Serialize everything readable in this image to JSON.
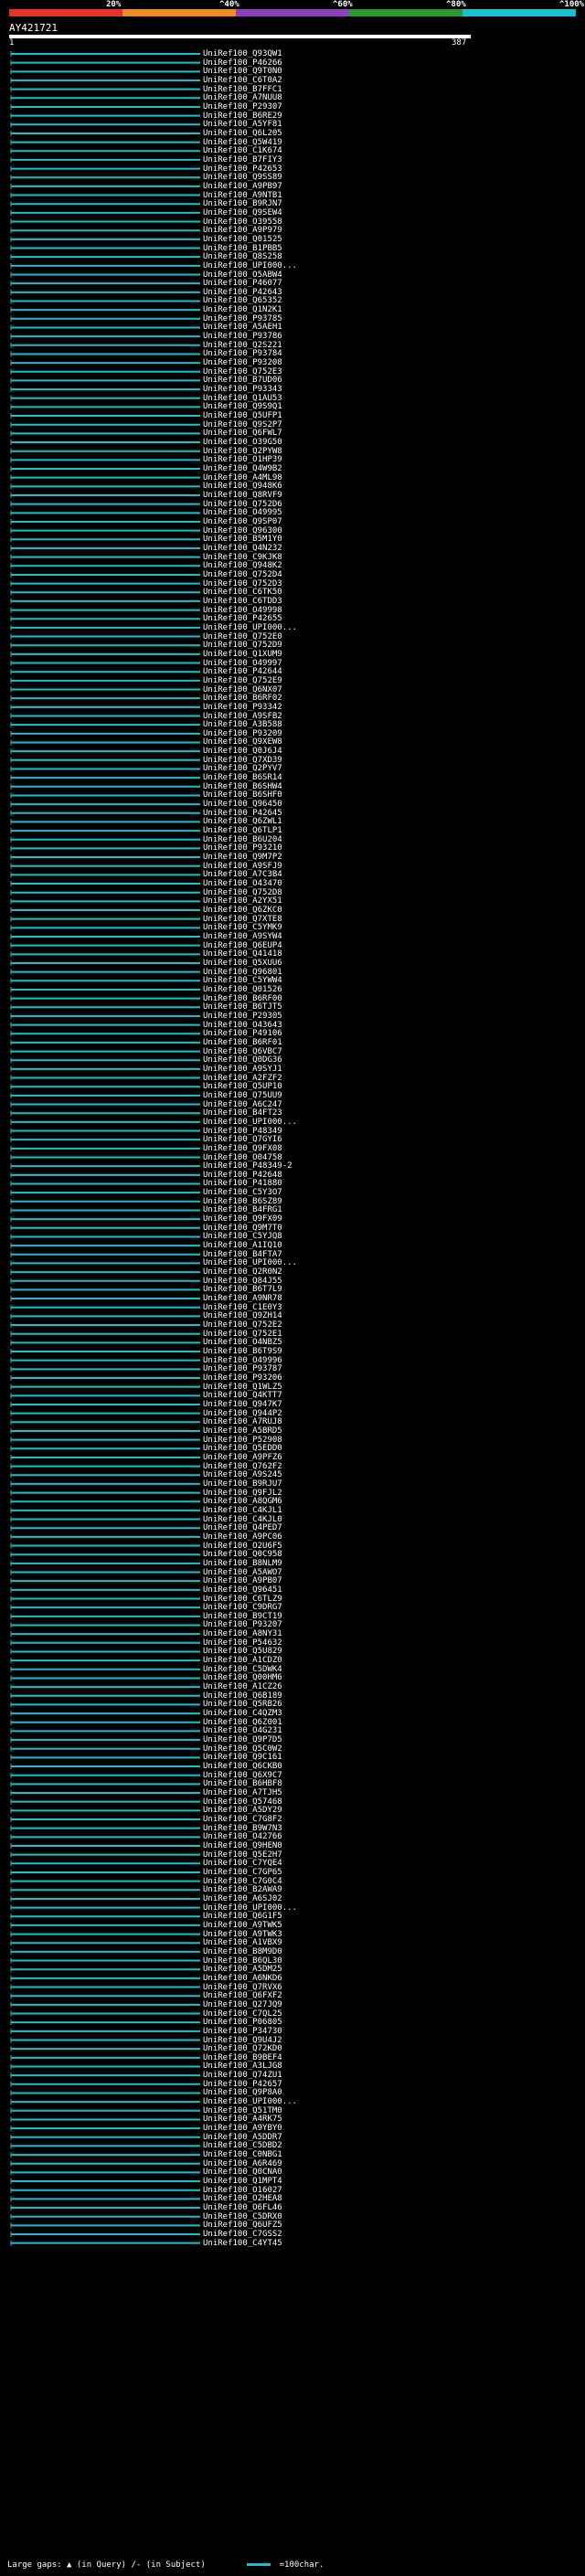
{
  "chart_data": {
    "type": "alignment-overview",
    "query": {
      "id": "AY421721",
      "length": 387
    },
    "scale": {
      "labels": [
        "20%",
        "^40%",
        "^60%",
        "^80%",
        "^100%"
      ],
      "colors": [
        "#e5332a",
        "#f08a24",
        "#8c3fbf",
        "#2d9a2d",
        "#19c1d0"
      ]
    },
    "hit_color": "#19c1d0",
    "hits": [
      "UniRef100_Q93QW1",
      "UniRef100_P46266",
      "UniRef100_Q9T0N0",
      "UniRef100_C6T0A2",
      "UniRef100_B7FFC1",
      "UniRef100_A7NUU8",
      "UniRef100_P29307",
      "UniRef100_B6RE29",
      "UniRef100_A5YF81",
      "UniRef100_Q6L205",
      "UniRef100_Q5W419",
      "UniRef100_C1K674",
      "UniRef100_B7FIY3",
      "UniRef100_P42653",
      "UniRef100_Q9SS89",
      "UniRef100_A9PB97",
      "UniRef100_A9NTB1",
      "UniRef100_B9RJN7",
      "UniRef100_Q9SEW4",
      "UniRef100_O39558",
      "UniRef100_A9P979",
      "UniRef100_Q01525",
      "UniRef100_B1PBB5",
      "UniRef100_Q8S258",
      "UniRef100_UPI000...",
      "UniRef100_O5ABW4",
      "UniRef100_P46077",
      "UniRef100_P42643",
      "UniRef100_Q65352",
      "UniRef100_Q1N2K1",
      "UniRef100_P93785",
      "UniRef100_A5AEH1",
      "UniRef100_P93786",
      "UniRef100_Q2S221",
      "UniRef100_P93784",
      "UniRef100_P93208",
      "UniRef100_Q752E3",
      "UniRef100_B7UD06",
      "UniRef100_P93343",
      "UniRef100_Q1AU53",
      "UniRef100_Q9S9Q1",
      "UniRef100_Q5UFP1",
      "UniRef100_Q9S2P7",
      "UniRef100_Q6FWL7",
      "UniRef100_O39G50",
      "UniRef100_Q2PYW8",
      "UniRef100_O1HP39",
      "UniRef100_Q4W9B2",
      "UniRef100_A4ML98",
      "UniRef100_Q948K6",
      "UniRef100_Q8RVF9",
      "UniRef100_Q752D6",
      "UniRef100_O49995",
      "UniRef100_Q9SP07",
      "UniRef100_Q96300",
      "UniRef100_B5M1Y0",
      "UniRef100_Q4N232",
      "UniRef100_C9KJK8",
      "UniRef100_Q948K2",
      "UniRef100_Q752D4",
      "UniRef100_Q752D3",
      "UniRef100_C6TK50",
      "UniRef100_C6TDD3",
      "UniRef100_O49998",
      "UniRef100_P42655",
      "UniRef100_UPI000...",
      "UniRef100_Q752E0",
      "UniRef100_Q752D9",
      "UniRef100_Q1XUM9",
      "UniRef100_O49997",
      "UniRef100_P42644",
      "UniRef100_Q752E9",
      "UniRef100_Q6NX07",
      "UniRef100_B6RF02",
      "UniRef100_P93342",
      "UniRef100_A9SFB2",
      "UniRef100_A3B588",
      "UniRef100_P93209",
      "UniRef100_Q9XEW8",
      "UniRef100_Q0J6J4",
      "UniRef100_Q7XD39",
      "UniRef100_Q2PYV7",
      "UniRef100_B6SR14",
      "UniRef100_B6SHW4",
      "UniRef100_B6SHF0",
      "UniRef100_Q96450",
      "UniRef100_P42645",
      "UniRef100_Q6ZWL1",
      "UniRef100_Q6TLP1",
      "UniRef100_B6U204",
      "UniRef100_P93210",
      "UniRef100_Q9M7P2",
      "UniRef100_A9SFJ9",
      "UniRef100_A7C3B4",
      "UniRef100_O43470",
      "UniRef100_Q752D8",
      "UniRef100_A2YX51",
      "UniRef100_Q6ZKC0",
      "UniRef100_Q7XTE8",
      "UniRef100_C5YMK9",
      "UniRef100_A9SYW4",
      "UniRef100_Q6EUP4",
      "UniRef100_Q41418",
      "UniRef100_Q5XUU6",
      "UniRef100_Q96801",
      "UniRef100_C5YWW4",
      "UniRef100_Q01526",
      "UniRef100_B6RF00",
      "UniRef100_B6TJT5",
      "UniRef100_P29305",
      "UniRef100_O43643",
      "UniRef100_P49106",
      "UniRef100_B6RF01",
      "UniRef100_Q6VBC7",
      "UniRef100_Q0DG36",
      "UniRef100_A9SYJ1",
      "UniRef100_A2FZF2",
      "UniRef100_Q5UP10",
      "UniRef100_Q75UU9",
      "UniRef100_A6C247",
      "UniRef100_B4FT23",
      "UniRef100_UPI000...",
      "UniRef100_P48349",
      "UniRef100_Q7GYI6",
      "UniRef100_Q9FX08",
      "UniRef100_O04758",
      "UniRef100_P48349-2",
      "UniRef100_P42648",
      "UniRef100_P41880",
      "UniRef100_C5Y3O7",
      "UniRef100_B6SZ89",
      "UniRef100_B4FRG1",
      "UniRef100_Q9FX09",
      "UniRef100_Q9M7T0",
      "UniRef100_C5YJQ8",
      "UniRef100_A1IQ10",
      "UniRef100_B4FTA7",
      "UniRef100_UPI000...",
      "UniRef100_Q2R0N2",
      "UniRef100_Q84J55",
      "UniRef100_B6T7L9",
      "UniRef100_A9NR78",
      "UniRef100_C1E0Y3",
      "UniRef100_Q9ZH14",
      "UniRef100_Q752E2",
      "UniRef100_Q752E1",
      "UniRef100_O4NBZ5",
      "UniRef100_B6T9S9",
      "UniRef100_O49996",
      "UniRef100_P93787",
      "UniRef100_P93206",
      "UniRef100_Q1WLZ5",
      "UniRef100_Q4KTT7",
      "UniRef100_Q947K7",
      "UniRef100_Q944P2",
      "UniRef100_A7RUJ8",
      "UniRef100_A5BRD5",
      "UniRef100_P52908",
      "UniRef100_Q5EDD0",
      "UniRef100_A9PFZ6",
      "UniRef100_Q762F2",
      "UniRef100_A9S245",
      "UniRef100_B9RJU7",
      "UniRef100_Q9FJL2",
      "UniRef100_A8QGM6",
      "UniRef100_C4KJL1",
      "UniRef100_C4KJL0",
      "UniRef100_Q4PED7",
      "UniRef100_A9PC06",
      "UniRef100_O2U6F5",
      "UniRef100_Q0C958",
      "UniRef100_B8NLM9",
      "UniRef100_A5AWO7",
      "UniRef100_A9PB07",
      "UniRef100_Q96451",
      "UniRef100_C6TLZ9",
      "UniRef100_C9DRG7",
      "UniRef100_B9CT19",
      "UniRef100_P93207",
      "UniRef100_A8NY31",
      "UniRef100_P54632",
      "UniRef100_Q5U829",
      "UniRef100_A1CDZ0",
      "UniRef100_C5DWK4",
      "UniRef100_Q00HM6",
      "UniRef100_A1CZ26",
      "UniRef100_Q6B189",
      "UniRef100_Q5RB26",
      "UniRef100_C4QZM3",
      "UniRef100_Q6Z001",
      "UniRef100_O4G231",
      "UniRef100_Q9P7D5",
      "UniRef100_Q5C0W2",
      "UniRef100_Q9C161",
      "UniRef100_Q6CKB0",
      "UniRef100_Q6X9C7",
      "UniRef100_B6HBF8",
      "UniRef100_A7TJH5",
      "UniRef100_Q57468",
      "UniRef100_A5DY29",
      "UniRef100_C7G8F2",
      "UniRef100_B9W7N3",
      "UniRef100_O42766",
      "UniRef100_Q9HEN0",
      "UniRef100_Q5E2H7",
      "UniRef100_C7YQE4",
      "UniRef100_C7GP65",
      "UniRef100_C7G0C4",
      "UniRef100_B2AWA9",
      "UniRef100_A6SJ02",
      "UniRef100_UPI000...",
      "UniRef100_Q6G1F5",
      "UniRef100_A9TWK5",
      "UniRef100_A9TWK3",
      "UniRef100_A1VBX9",
      "UniRef100_B8M9D0",
      "UniRef100_B6QL30",
      "UniRef100_A5DM25",
      "UniRef100_A6NKD6",
      "UniRef100_Q7RVX6",
      "UniRef100_Q6FXF2",
      "UniRef100_Q27JQ9",
      "UniRef100_C7QL25",
      "UniRef100_P06805",
      "UniRef100_P34730",
      "UniRef100_Q9U4J2",
      "UniRef100_Q72KD0",
      "UniRef100_B9BEF4",
      "UniRef100_A3LJG8",
      "UniRef100_Q74ZU1",
      "UniRef100_P42657",
      "UniRef100_Q9P8A0",
      "UniRef100_UPI000...",
      "UniRef100_Q51TM0",
      "UniRef100_A4RK75",
      "UniRef100_A9YBY0",
      "UniRef100_A5DDR7",
      "UniRef100_C5DBD2",
      "UniRef100_C0NBG1",
      "UniRef100_A6R469",
      "UniRef100_Q0CNA0",
      "UniRef100_Q1MPT4",
      "UniRef100_O16027",
      "UniRef100_O2HEA8",
      "UniRef100_O6FL46",
      "UniRef100_C5DRX0",
      "UniRef100_Q6UFZ5",
      "UniRef100_C7GSS2",
      "UniRef100_C4YT45"
    ]
  },
  "footer": {
    "large_gaps_label": "Large gaps:",
    "gap_query_label": "(in Query)",
    "gap_subject_label": "/- (in Subject)",
    "legend_label": "=100char."
  }
}
